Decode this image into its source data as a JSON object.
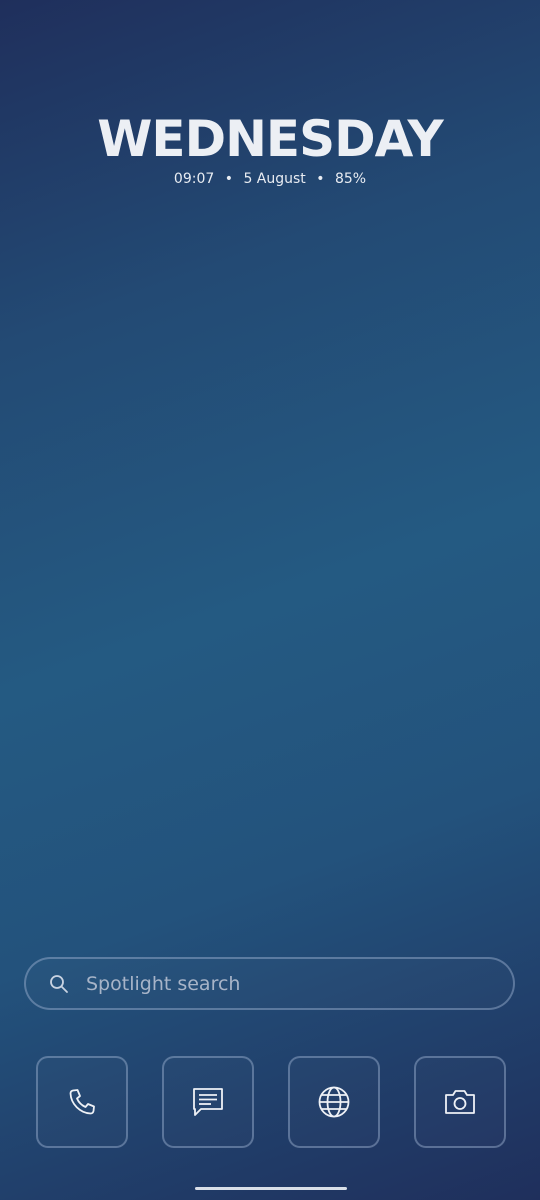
{
  "clock_widget": {
    "day": "WEDNESDAY",
    "time": "09:07",
    "date": "5 August",
    "battery": "85%",
    "separator": "•"
  },
  "search": {
    "placeholder": "Spotlight search",
    "icon": "search-icon"
  },
  "dock": {
    "apps": [
      {
        "name": "Phone",
        "icon": "phone-icon"
      },
      {
        "name": "Messages",
        "icon": "message-icon"
      },
      {
        "name": "Browser",
        "icon": "globe-icon"
      },
      {
        "name": "Camera",
        "icon": "camera-icon"
      }
    ]
  },
  "colors": {
    "background_dark": "#1f2f5c",
    "background_light": "#245a82",
    "text": "#eceff4",
    "outline": "#a0b4d2"
  }
}
